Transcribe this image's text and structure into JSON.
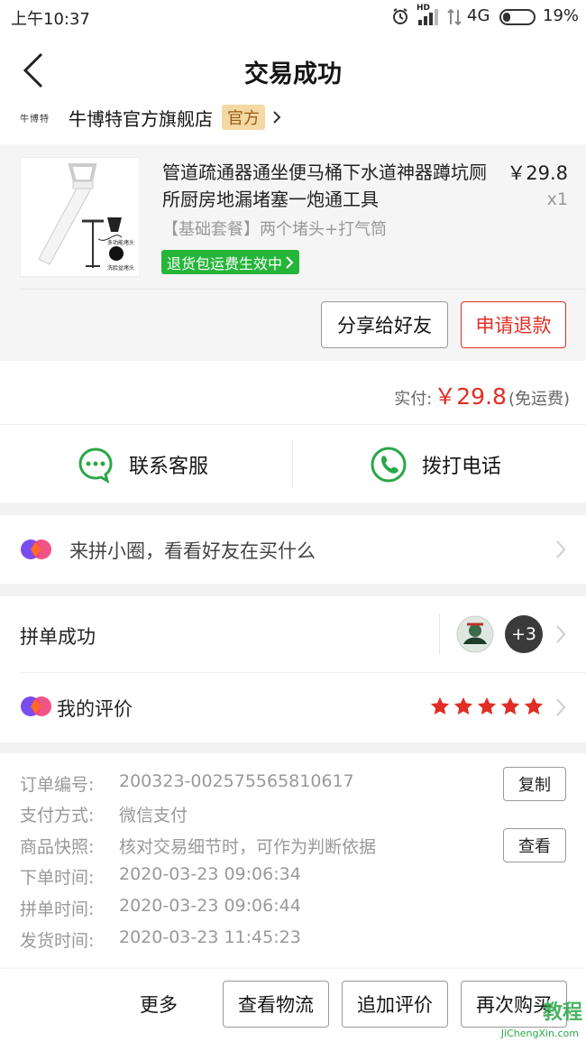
{
  "status_bar": {
    "time": "上午10:37",
    "network": "4G",
    "hd": "HD",
    "battery": "19%"
  },
  "header": {
    "title": "交易成功"
  },
  "store": {
    "logo_text": "牛博特",
    "name": "牛博特官方旗舰店",
    "badge": "官方"
  },
  "product": {
    "name": "管道疏通器通坐便马桶下水道神器蹲坑厕所厨房地漏堵塞一炮通工具",
    "price": "￥29.8",
    "quantity": "x1",
    "spec": "【基础套餐】两个堵头+打气筒",
    "refund_tag": "退货包运费生效中",
    "image_labels": [
      "多功能堵头",
      "洗脸盆堵头"
    ]
  },
  "actions": {
    "share": "分享给好友",
    "refund": "申请退款"
  },
  "payment": {
    "label": "实付:",
    "amount": "￥29.8",
    "note": "(免运费)"
  },
  "contact": {
    "service": "联系客服",
    "phone": "拨打电话"
  },
  "circle": {
    "text": "来拼小圈，看看好友在买什么"
  },
  "group_buy": {
    "label": "拼单成功",
    "extra_count": "+3"
  },
  "review": {
    "label": "我的评价",
    "stars": 5
  },
  "order_info": {
    "rows": [
      {
        "key": "订单编号:",
        "value": "200323-002575565810617"
      },
      {
        "key": "支付方式:",
        "value": "微信支付"
      },
      {
        "key": "商品快照:",
        "value": "核对交易细节时，可作为判断依据"
      },
      {
        "key": "下单时间:",
        "value": "2020-03-23 09:06:34"
      },
      {
        "key": "拼单时间:",
        "value": "2020-03-23 09:06:44"
      },
      {
        "key": "发货时间:",
        "value": "2020-03-23 11:45:23"
      }
    ],
    "copy_btn": "复制",
    "view_btn": "查看"
  },
  "bottom_bar": {
    "more": "更多",
    "logistics": "查看物流",
    "add_review": "追加评价",
    "rebuy": "再次购买"
  },
  "watermark": {
    "text": "教程",
    "sub": "JiChengXin.com"
  },
  "colors": {
    "accent": "#e02e24",
    "green": "#25b538",
    "wechat": "#2aa748"
  }
}
